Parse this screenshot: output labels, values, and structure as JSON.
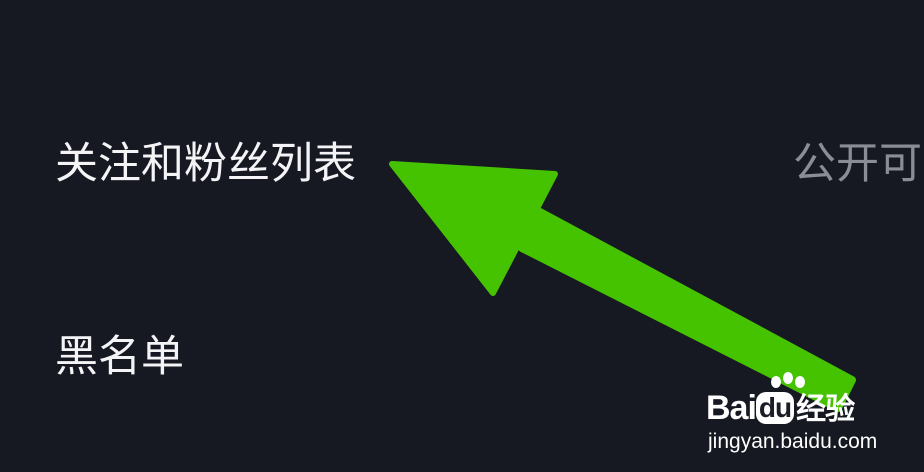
{
  "settings": {
    "items": [
      {
        "label": "关注和粉丝列表",
        "value": "公开可"
      },
      {
        "label": "黑名单"
      }
    ]
  },
  "annotation": {
    "arrow_color": "#46c300"
  },
  "watermark": {
    "logo_bai": "Bai",
    "logo_du": "du",
    "logo_jingyan": "经验",
    "url": "jingyan.baidu.com"
  },
  "colors": {
    "background": "#161822",
    "label": "#f4f4f6",
    "value": "#8b8d95"
  }
}
